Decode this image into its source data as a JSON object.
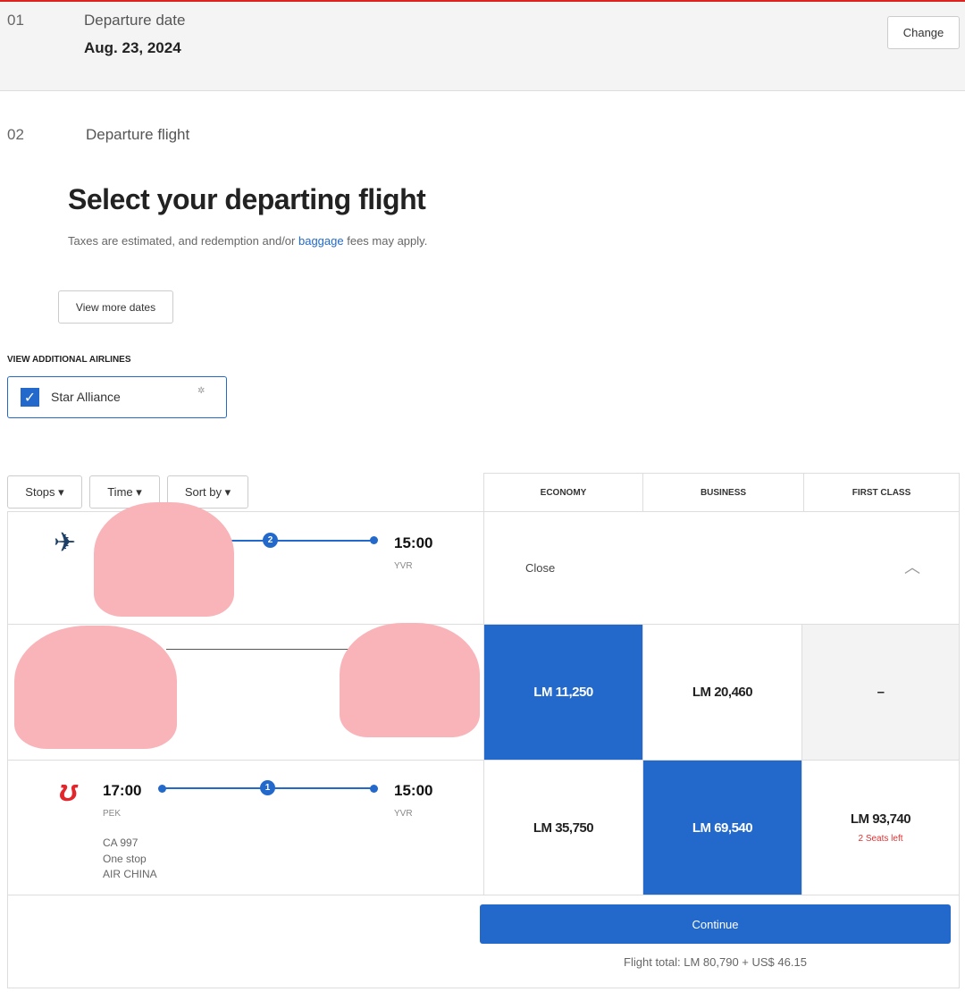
{
  "step1": {
    "number": "01",
    "label": "Departure date",
    "value": "Aug. 23, 2024",
    "change_label": "Change"
  },
  "step2": {
    "number": "02",
    "label": "Departure flight"
  },
  "heading": "Select your departing flight",
  "subtext": {
    "before": "Taxes are estimated, and redemption and/or ",
    "link": "baggage",
    "after": " fees may apply."
  },
  "view_more_dates": "View more dates",
  "additional_airlines": {
    "title": "VIEW ADDITIONAL AIRLINES",
    "option": "Star Alliance",
    "checked": true
  },
  "filters": [
    {
      "label": "Stops"
    },
    {
      "label": "Time"
    },
    {
      "label": "Sort by"
    }
  ],
  "cabins": [
    "ECONOMY",
    "BUSINESS",
    "FIRST CLASS"
  ],
  "expanded_row": {
    "stops": "2",
    "arrive_time": "15:00",
    "arrive_code": "YVR",
    "close_label": "Close"
  },
  "row2": {
    "economy": "LM 11,250",
    "business": "LM 20,460",
    "first": "–"
  },
  "row3": {
    "depart_time": "17:00",
    "depart_code": "PEK",
    "arrive_time": "15:00",
    "arrive_code": "YVR",
    "stops": "1",
    "flight_no": "CA 997",
    "stop_text": "One stop",
    "airline": "AIR CHINA",
    "economy": "LM 35,750",
    "business": "LM 69,540",
    "first": "LM 93,740",
    "first_note": "2 Seats left"
  },
  "continue_label": "Continue",
  "flight_total": "Flight total: LM 80,790 + US$ 46.15",
  "colors": {
    "accent": "#2369cb",
    "alert": "#d33",
    "brand_red": "#e3262b"
  }
}
